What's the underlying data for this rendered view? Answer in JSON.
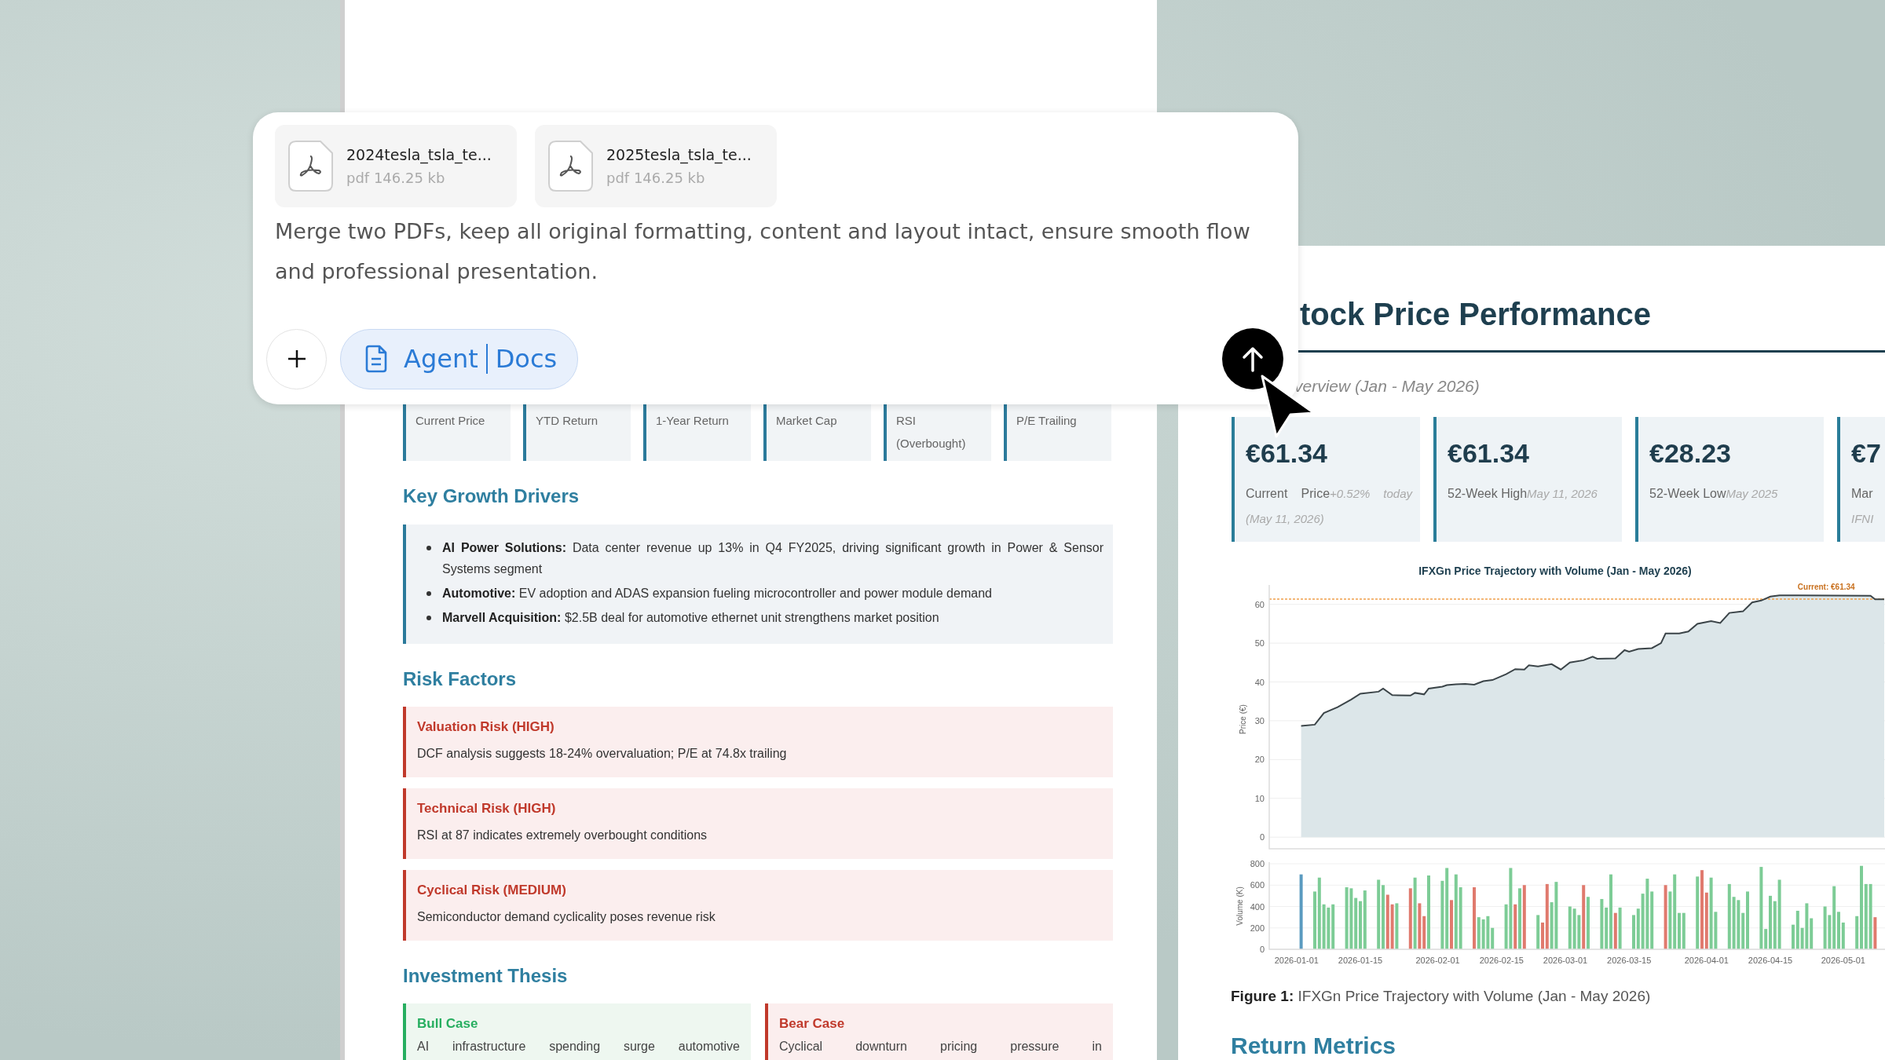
{
  "prompt_card": {
    "attachments": [
      {
        "name": "2024tesla_tsla_te...",
        "meta": "pdf 146.25 kb"
      },
      {
        "name": "2025tesla_tsla_te...",
        "meta": "pdf 146.25 kb"
      }
    ],
    "text": "Merge two PDFs, keep all original formatting, content and layout intact, ensure smooth flow and professional presentation.",
    "mode_button": {
      "parts": [
        "Agent",
        "Docs"
      ]
    }
  },
  "left_document": {
    "metric_cards": [
      {
        "label": "Current Price"
      },
      {
        "label": "YTD Return"
      },
      {
        "label": "1-Year Return"
      },
      {
        "label": "Market Cap"
      },
      {
        "label": "RSI (Overbought)"
      },
      {
        "label": "P/E Trailing"
      }
    ],
    "growth": {
      "heading": "Key Growth Drivers",
      "items": [
        "**AI Power Solutions:** Data center revenue up 13% in Q4 FY2025, driving significant growth in Power & Sensor Systems segment",
        "**Automotive:** EV adoption and ADAS expansion fueling microcontroller and power module demand",
        "**Marvell Acquisition:** $2.5B deal for automotive ethernet unit strengthens market position"
      ]
    },
    "risks": {
      "heading": "Risk Factors",
      "items": [
        {
          "title": "Valuation Risk (HIGH)",
          "text": "DCF analysis suggests 18-24% overvaluation; P/E at 74.8x trailing"
        },
        {
          "title": "Technical Risk (HIGH)",
          "text": "RSI at 87 indicates extremely overbought conditions"
        },
        {
          "title": "Cyclical Risk (MEDIUM)",
          "text": "Semiconductor demand cyclicality poses revenue risk"
        }
      ]
    },
    "thesis": {
      "heading": "Investment Thesis",
      "cases": [
        {
          "kind": "bull",
          "title": "Bull Case",
          "text": "AI infrastructure spending surge automotive"
        },
        {
          "kind": "bear",
          "title": "Bear Case",
          "text": "Cyclical downturn pricing pressure in"
        }
      ]
    }
  },
  "right_document": {
    "heading": "tock Price Performance",
    "subtitle": "verview (Jan - May 2026)",
    "metric_cards": [
      {
        "value": "€61.34",
        "label": "Current Price",
        "note": "+0.52% today (May 11, 2026)"
      },
      {
        "value": "€61.34",
        "label": "52-Week High",
        "note": "May 11, 2026"
      },
      {
        "value": "€28.23",
        "label": "52-Week Low",
        "note": "May 2025"
      },
      {
        "value": "€7",
        "label": "Mar",
        "note": "IFNI"
      }
    ],
    "price_chart": {
      "chart_data": {
        "type": "area",
        "title": "IFXGn Price Trajectory with Volume (Jan - May 2026)",
        "ylabel": "Price (€)",
        "x": [
          "2026-01-02",
          "2026-01-05",
          "2026-01-07",
          "2026-01-10",
          "2026-01-13",
          "2026-01-15",
          "2026-01-19",
          "2026-01-20",
          "2026-01-22",
          "2026-01-26",
          "2026-01-27",
          "2026-01-29",
          "2026-01-30",
          "2026-02-02",
          "2026-02-03",
          "2026-02-05",
          "2026-02-07",
          "2026-02-09",
          "2026-02-11",
          "2026-02-13",
          "2026-02-16",
          "2026-02-18",
          "2026-02-20",
          "2026-02-21",
          "2026-02-23",
          "2026-02-26",
          "2026-02-28",
          "2026-03-02",
          "2026-03-05",
          "2026-03-07",
          "2026-03-08",
          "2026-03-12",
          "2026-03-14",
          "2026-03-15",
          "2026-03-17",
          "2026-03-20",
          "2026-03-22",
          "2026-03-23",
          "2026-03-26",
          "2026-03-28",
          "2026-03-30",
          "2026-04-02",
          "2026-04-04",
          "2026-04-06",
          "2026-04-09",
          "2026-04-11",
          "2026-04-13",
          "2026-04-15",
          "2026-04-17",
          "2026-04-21",
          "2026-05-07",
          "2026-05-08",
          "2026-05-10"
        ],
        "series": [
          {
            "color": "#3b4448",
            "values": [
              28.7,
              29,
              32,
              33.5,
              35.5,
              37,
              37.5,
              38.3,
              36.6,
              36.5,
              37.2,
              36.8,
              38.3,
              38.8,
              39.2,
              39.4,
              39.5,
              39.3,
              40.2,
              40.5,
              42,
              43.3,
              43.2,
              44.3,
              44,
              44.6,
              43.2,
              45,
              45.6,
              46.5,
              46,
              46.1,
              48.2,
              47.8,
              48.5,
              48.7,
              50,
              52.5,
              52.5,
              53,
              55,
              55.7,
              55.2,
              57.8,
              58.2,
              60.5,
              61,
              62,
              62.3,
              62.3,
              62.2,
              61.3,
              61.3
            ]
          }
        ],
        "xlim": [
          "2025-12-26",
          "2026-05-10"
        ],
        "ylim": [
          -3,
          65
        ],
        "yticks": [
          0,
          10,
          20,
          30,
          40,
          50,
          60
        ],
        "grid": true,
        "ref_lines": [
          {
            "axis": "y",
            "value": 61.34,
            "color": "#f0a04b"
          }
        ],
        "annotations": [
          {
            "text": "Current: €61.34",
            "x": "2026-04-21",
            "y": 61.34
          }
        ]
      }
    },
    "volume_chart": {
      "chart_data": {
        "type": "bar",
        "ylabel": "Volume (K)",
        "x": [
          "2026-01-02",
          "2026-01-05",
          "2026-01-06",
          "2026-01-07",
          "2026-01-08",
          "2026-01-09",
          "2026-01-12",
          "2026-01-13",
          "2026-01-14",
          "2026-01-15",
          "2026-01-16",
          "2026-01-19",
          "2026-01-20",
          "2026-01-21",
          "2026-01-22",
          "2026-01-23",
          "2026-01-26",
          "2026-01-27",
          "2026-01-28",
          "2026-01-29",
          "2026-01-30",
          "2026-02-02",
          "2026-02-03",
          "2026-02-04",
          "2026-02-05",
          "2026-02-06",
          "2026-02-09",
          "2026-02-10",
          "2026-02-11",
          "2026-02-12",
          "2026-02-13",
          "2026-02-16",
          "2026-02-17",
          "2026-02-18",
          "2026-02-19",
          "2026-02-20",
          "2026-02-23",
          "2026-02-24",
          "2026-02-25",
          "2026-02-26",
          "2026-02-27",
          "2026-03-02",
          "2026-03-03",
          "2026-03-04",
          "2026-03-05",
          "2026-03-06",
          "2026-03-09",
          "2026-03-10",
          "2026-03-11",
          "2026-03-12",
          "2026-03-13",
          "2026-03-16",
          "2026-03-17",
          "2026-03-18",
          "2026-03-19",
          "2026-03-20",
          "2026-03-23",
          "2026-03-24",
          "2026-03-25",
          "2026-03-26",
          "2026-03-27",
          "2026-03-30",
          "2026-03-31",
          "2026-04-01",
          "2026-04-02",
          "2026-04-03",
          "2026-04-06",
          "2026-04-07",
          "2026-04-08",
          "2026-04-09",
          "2026-04-10",
          "2026-04-13",
          "2026-04-14",
          "2026-04-15",
          "2026-04-16",
          "2026-04-17",
          "2026-04-20",
          "2026-04-21",
          "2026-04-22",
          "2026-04-23",
          "2026-04-24",
          "2026-04-27",
          "2026-04-28",
          "2026-04-29",
          "2026-04-30",
          "2026-05-01",
          "2026-05-04",
          "2026-05-05",
          "2026-05-06",
          "2026-05-07",
          "2026-05-08"
        ],
        "series": [
          {
            "color": "#5b9bc0",
            "values": [
              700,
              null,
              null,
              null,
              null,
              null,
              null,
              null,
              null,
              null,
              null,
              null,
              null,
              null,
              null,
              null,
              null,
              null,
              null,
              null,
              null,
              null,
              null,
              null,
              null,
              null,
              null,
              null,
              null,
              null,
              null,
              null,
              null,
              null,
              null,
              null,
              null,
              null,
              null,
              null,
              null,
              null,
              null,
              null,
              null,
              null,
              null,
              null,
              null,
              null,
              null,
              null,
              null,
              null,
              null,
              null,
              null,
              null,
              null,
              null,
              null,
              null,
              null,
              null,
              null,
              null,
              null,
              null,
              null,
              null,
              null,
              null,
              null,
              null,
              null,
              null,
              null,
              null,
              null,
              null,
              null,
              null,
              null,
              null,
              null,
              null,
              null,
              null,
              null,
              null,
              null
            ]
          },
          {
            "color": "#7dcc96",
            "values": [
              null,
              540,
              670,
              420,
              390,
              420,
              580,
              570,
              480,
              450,
              550,
              650,
              600,
              null,
              null,
              430,
              null,
              670,
              null,
              null,
              690,
              640,
              760,
              null,
              700,
              580,
              null,
              300,
              280,
              310,
              200,
              420,
              760,
              null,
              570,
              null,
              320,
              null,
              null,
              440,
              630,
              400,
              380,
              320,
              null,
              490,
              470,
              390,
              700,
              null,
              390,
              320,
              380,
              520,
              660,
              540,
              null,
              540,
              700,
              340,
              340,
              680,
              null,
              null,
              670,
              350,
              610,
              490,
              460,
              340,
              540,
              770,
              190,
              500,
              450,
              650,
              230,
              360,
              200,
              430,
              290,
              400,
              320,
              590,
              350,
              250,
              310,
              780,
              610,
              610,
              null
            ]
          },
          {
            "color": "#e07a6e",
            "values": [
              null,
              null,
              null,
              null,
              null,
              null,
              null,
              null,
              null,
              null,
              null,
              null,
              null,
              510,
              420,
              null,
              570,
              null,
              430,
              310,
              null,
              null,
              null,
              460,
              null,
              null,
              580,
              null,
              null,
              null,
              null,
              null,
              null,
              420,
              null,
              600,
              null,
              250,
              610,
              null,
              null,
              null,
              null,
              null,
              600,
              null,
              null,
              null,
              null,
              340,
              null,
              null,
              null,
              null,
              null,
              null,
              600,
              null,
              null,
              null,
              null,
              null,
              740,
              530,
              null,
              null,
              null,
              null,
              null,
              null,
              null,
              null,
              null,
              null,
              null,
              null,
              null,
              null,
              null,
              null,
              null,
              null,
              null,
              null,
              null,
              null,
              null,
              null,
              null,
              null,
              300
            ]
          }
        ],
        "xlim": [
          "2025-12-26",
          "2026-05-10"
        ],
        "ylim": [
          0,
          800
        ],
        "yticks": [
          0,
          200,
          400,
          600,
          800
        ],
        "grid": true,
        "xticks": [
          "2026-01-01",
          "2026-01-15",
          "2026-02-01",
          "2026-02-15",
          "2026-03-01",
          "2026-03-15",
          "2026-04-01",
          "2026-04-15",
          "2026-05-01"
        ]
      }
    },
    "caption": "**Figure 1:** IFXGn Price Trajectory with Volume (Jan - May 2026)",
    "next_heading": "Return Metrics"
  }
}
